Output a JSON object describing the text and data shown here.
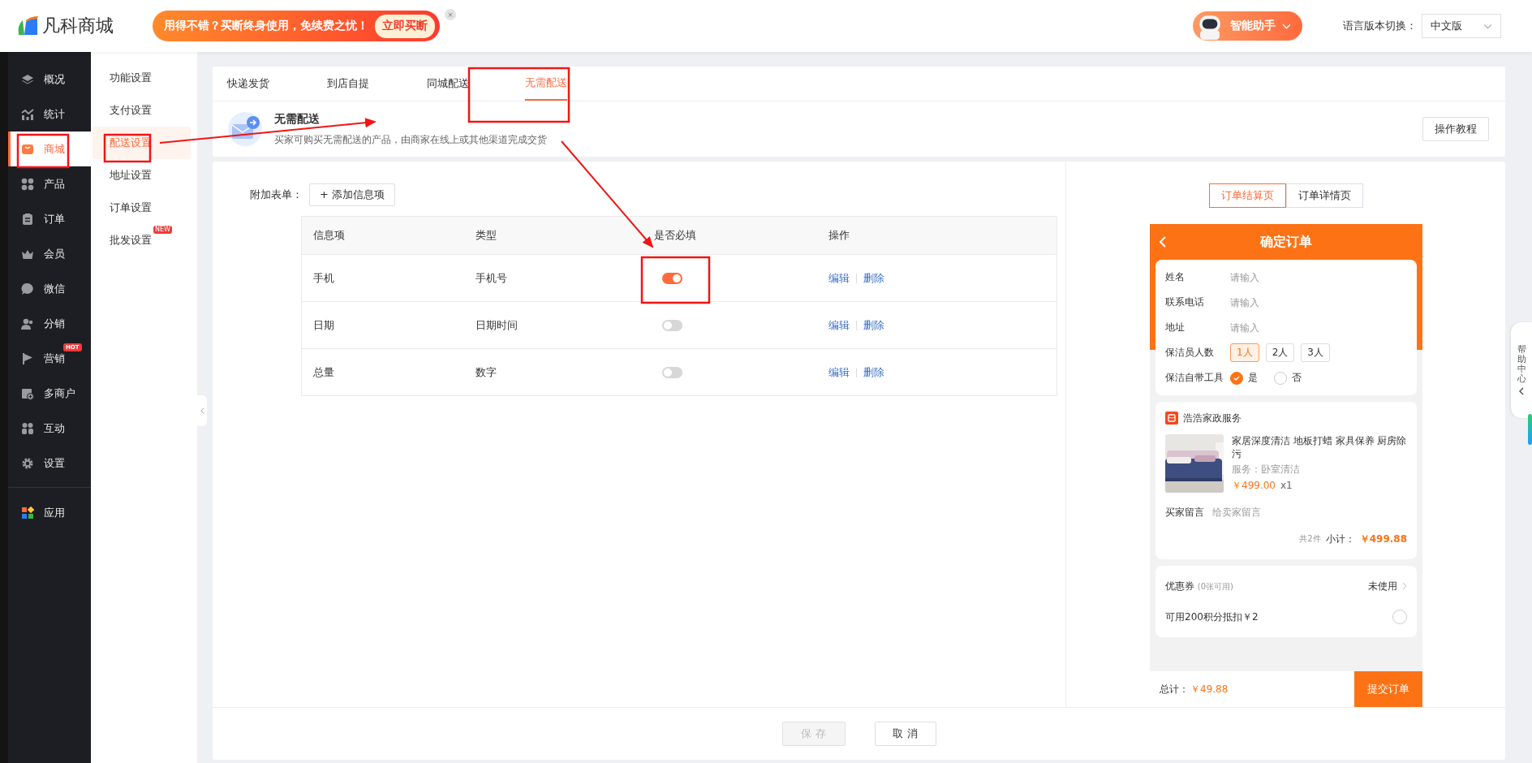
{
  "header": {
    "logo_text": "凡科商城",
    "promo": {
      "text": "用得不错？买断终身使用，免续费之忧！",
      "button": "立即买断",
      "close": "×"
    },
    "assistant": {
      "label": "智能助手"
    },
    "language": {
      "label": "语言版本切换：",
      "value": "中文版"
    }
  },
  "sidebar": {
    "items": [
      {
        "label": "概况",
        "kind": "layers",
        "selected": false
      },
      {
        "label": "统计",
        "kind": "chart",
        "selected": false
      },
      {
        "label": "商城",
        "kind": "bag",
        "selected": true
      },
      {
        "label": "产品",
        "kind": "grid",
        "selected": false
      },
      {
        "label": "订单",
        "kind": "clipboard",
        "selected": false
      },
      {
        "label": "会员",
        "kind": "crown",
        "selected": false
      },
      {
        "label": "微信",
        "kind": "chat",
        "selected": false
      },
      {
        "label": "分销",
        "kind": "users",
        "selected": false
      },
      {
        "label": "营销",
        "kind": "flag",
        "selected": false,
        "badge": "HOT"
      },
      {
        "label": "多商户",
        "kind": "store",
        "selected": false
      },
      {
        "label": "互动",
        "kind": "people",
        "selected": false
      },
      {
        "label": "设置",
        "kind": "gear",
        "selected": false
      }
    ],
    "apps": {
      "label": "应用"
    }
  },
  "submenu": {
    "items": [
      {
        "label": "功能设置",
        "selected": false
      },
      {
        "label": "支付设置",
        "selected": false
      },
      {
        "label": "配送设置",
        "selected": true
      },
      {
        "label": "地址设置",
        "selected": false
      },
      {
        "label": "订单设置",
        "selected": false
      },
      {
        "label": "批发设置",
        "selected": false,
        "badge": "NEW"
      }
    ]
  },
  "tabs": [
    {
      "label": "快递发货",
      "selected": false
    },
    {
      "label": "到店自提",
      "selected": false
    },
    {
      "label": "同城配送",
      "selected": false
    },
    {
      "label": "无需配送",
      "selected": true
    }
  ],
  "intro": {
    "title": "无需配送",
    "description": "买家可购买无需配送的产品，由商家在线上或其他渠道完成交货",
    "button": "操作教程"
  },
  "form": {
    "label": "附加表单：",
    "add_button": "+ 添加信息项",
    "table": {
      "columns": [
        "信息项",
        "类型",
        "是否必填",
        "操作"
      ],
      "rows": [
        {
          "name": "手机",
          "type": "手机号",
          "required": true,
          "actions": [
            "编辑",
            "删除"
          ]
        },
        {
          "name": "日期",
          "type": "日期时间",
          "required": false,
          "actions": [
            "编辑",
            "删除"
          ]
        },
        {
          "name": "总量",
          "type": "数字",
          "required": false,
          "actions": [
            "编辑",
            "删除"
          ]
        }
      ]
    }
  },
  "footer": {
    "save": {
      "label": "保 存",
      "disabled": true
    },
    "cancel": "取 消"
  },
  "preview": {
    "tabs": [
      {
        "label": "订单结算页",
        "selected": true
      },
      {
        "label": "订单详情页",
        "selected": false
      }
    ],
    "phone": {
      "title": "确定订单",
      "fields": [
        {
          "label": "姓名",
          "placeholder": "请输入"
        },
        {
          "label": "联系电话",
          "placeholder": "请输入"
        },
        {
          "label": "地址",
          "placeholder": "请输入"
        }
      ],
      "headcount": {
        "label": "保洁员人数",
        "options": [
          {
            "label": "1人",
            "selected": true
          },
          {
            "label": "2人",
            "selected": false
          },
          {
            "label": "3人",
            "selected": false
          }
        ]
      },
      "tools": {
        "label": "保洁自带工具",
        "options": [
          {
            "label": "是",
            "selected": true
          },
          {
            "label": "否",
            "selected": false
          }
        ]
      },
      "shop": {
        "name": "浩浩家政服务",
        "product": {
          "title": "家居深度清洁 地板打蜡 家具保养 厨房除污",
          "service": "服务：卧室清洁",
          "price": "￥499.00",
          "qty": "x1"
        },
        "note": {
          "label": "买家留言",
          "placeholder": "给卖家留言"
        },
        "count": "共2件",
        "subtotal_label": "小计：",
        "subtotal": "￥499.88"
      },
      "coupon": {
        "label": "优惠券",
        "hint": "(0张可用)",
        "value": "未使用"
      },
      "points": {
        "label": "可用200积分抵扣￥2",
        "checked": false
      },
      "total_label": "总计：",
      "total": "￥49.88",
      "submit": "提交订单"
    }
  },
  "help": {
    "label": "帮助中心"
  }
}
